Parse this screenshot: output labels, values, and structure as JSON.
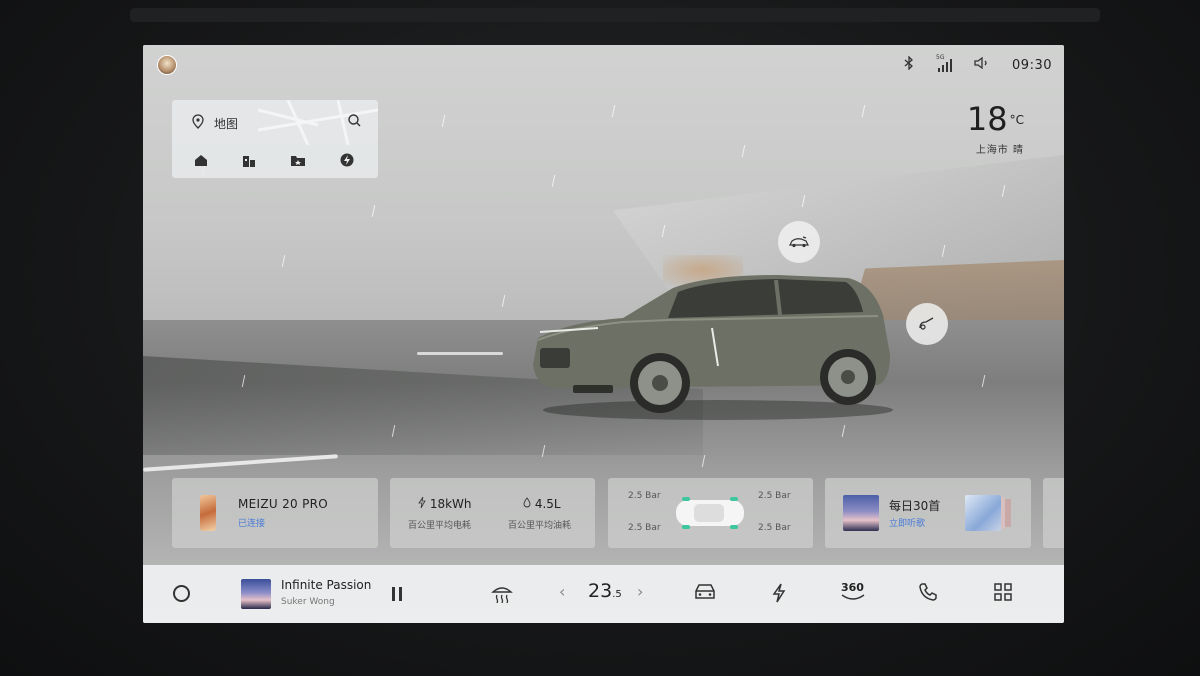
{
  "status_bar": {
    "time": "09:30",
    "signal_label": "5G",
    "icons": [
      "bluetooth-icon",
      "signal-5g-icon",
      "volume-icon"
    ]
  },
  "map_widget": {
    "label": "地图",
    "icons": [
      "map-pin-icon",
      "search-icon",
      "home-icon",
      "office-icon",
      "favorite-folder-icon",
      "charging-icon"
    ]
  },
  "weather": {
    "temperature": "18",
    "unit": "°C",
    "location": "上海市",
    "condition": "晴"
  },
  "hotspots": [
    "car-door-icon",
    "car-trunk-icon"
  ],
  "cards": {
    "phone": {
      "title": "MEIZU 20 PRO",
      "subtitle": "已连接"
    },
    "energy": {
      "electric_value": "18kWh",
      "electric_label": "百公里平均电耗",
      "fuel_value": "4.5L",
      "fuel_label": "百公里平均油耗"
    },
    "tires": {
      "front_left": "2.5 Bar",
      "front_right": "2.5 Bar",
      "rear_left": "2.5 Bar",
      "rear_right": "2.5 Bar"
    },
    "music": {
      "title": "每日30首",
      "subtitle": "立即听歌"
    }
  },
  "dock": {
    "track_title": "Infinite Passion",
    "track_artist": "Suker Wong",
    "temp_main": "23",
    "temp_decimal": ".5",
    "view_360_label": "360",
    "icons": [
      "home-circle-icon",
      "pause-icon",
      "defrost-icon",
      "chevron-left-icon",
      "chevron-right-icon",
      "car-icon",
      "energy-icon",
      "camera-360-icon",
      "phone-icon",
      "apps-grid-icon"
    ]
  },
  "colors": {
    "accent_blue": "#4a7bd8",
    "tire_indicator": "#3ec6a0"
  }
}
